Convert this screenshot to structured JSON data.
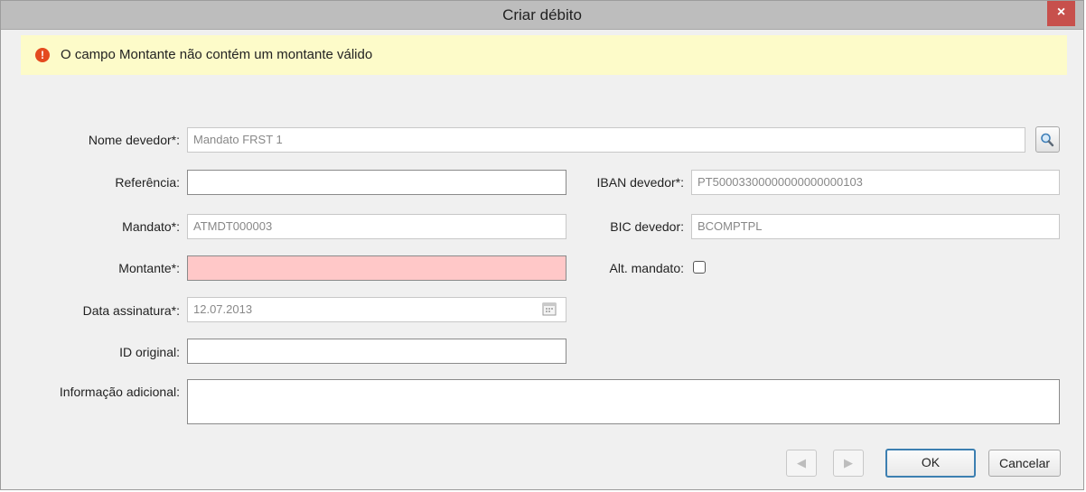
{
  "window": {
    "title": "Criar débito",
    "close_glyph": "×"
  },
  "error": {
    "icon_glyph": "!",
    "message": "O campo Montante não contém um montante válido"
  },
  "form": {
    "nome_devedor": {
      "label": "Nome devedor*:",
      "value": "Mandato FRST 1"
    },
    "referencia": {
      "label": "Referência:",
      "value": ""
    },
    "iban_devedor": {
      "label": "IBAN devedor*:",
      "value": "PT50003300000000000000103"
    },
    "mandato": {
      "label": "Mandato*:",
      "value": "ATMDT000003"
    },
    "bic_devedor": {
      "label": "BIC devedor:",
      "value": "BCOMPTPL"
    },
    "montante": {
      "label": "Montante*:",
      "value": ""
    },
    "alt_mandato": {
      "label": "Alt. mandato:",
      "checked": false
    },
    "data_assinatura": {
      "label": "Data assinatura*:",
      "value": "12.07.2013"
    },
    "id_original": {
      "label": "ID original:",
      "value": ""
    },
    "informacao_adicional": {
      "label": "Informação adicional:",
      "value": ""
    }
  },
  "buttons": {
    "prev_glyph": "◀",
    "next_glyph": "▶",
    "ok": "OK",
    "cancel": "Cancelar"
  },
  "colors": {
    "error_field": "#ffc8c8",
    "banner": "#fdfbc9",
    "error_icon": "#e44a1f",
    "close": "#c7504c",
    "default_border": "#3c7fb1"
  }
}
